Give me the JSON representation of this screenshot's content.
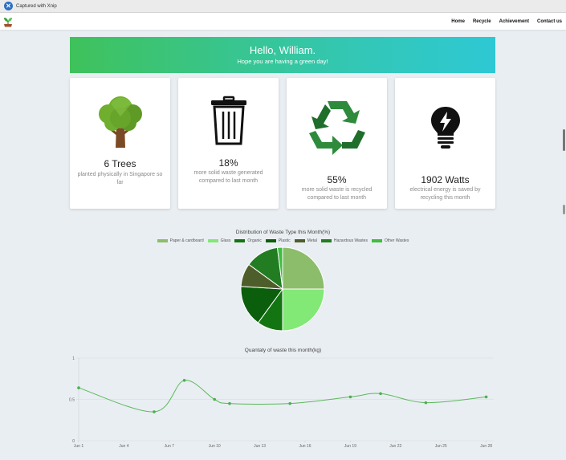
{
  "capture_bar": {
    "text": "Captured with Xnip"
  },
  "nav": {
    "links": [
      "Home",
      "Recycle",
      "Achievement",
      "Contact us"
    ]
  },
  "banner": {
    "title": "Hello, William.",
    "subtitle": "Hope you are having a green day!"
  },
  "cards": [
    {
      "icon": "tree-icon",
      "value": "6 Trees",
      "description": "planted physically in Singapore so far"
    },
    {
      "icon": "trash-bin-icon",
      "value": "18%",
      "description": "more solid waste generated compared to last month"
    },
    {
      "icon": "recycle-icon",
      "value": "55%",
      "description": "more solid waste is recycled compared to last month"
    },
    {
      "icon": "light-bulb-icon",
      "value": "1902 Watts",
      "description": "electrical energy is saved by recycling this month"
    }
  ],
  "colors": {
    "banner_start": "#3fc25b",
    "banner_end": "#2ec8d4",
    "line": "#5cb85c"
  },
  "chart_data": [
    {
      "type": "pie",
      "title": "Distribution of Waste Type this Month(%)",
      "legend_position": "top",
      "categories": [
        "Paper & cardboard",
        "Glass",
        "Organic",
        "Plastic",
        "Metal",
        "Hazardous Wastes",
        "Other Wastes"
      ],
      "values": [
        25,
        25,
        10,
        16,
        9,
        13,
        2
      ],
      "colors": [
        "#8cbd6b",
        "#82e876",
        "#137512",
        "#0b5e0b",
        "#4e5e2a",
        "#227d22",
        "#3fbd3f"
      ]
    },
    {
      "type": "line",
      "title": "Quantaty of waste this month(kg)",
      "grid": true,
      "ylim": [
        0,
        1
      ],
      "yticks": [
        0,
        0.5,
        1
      ],
      "xticks": [
        "Jun 1",
        "Jun 4",
        "Jun 7",
        "Jun 10",
        "Jun 13",
        "Jun 16",
        "Jun 19",
        "Jun 22",
        "Jun 25",
        "Jun 28"
      ],
      "x": [
        1,
        6,
        8,
        10,
        11,
        15,
        19,
        21,
        24,
        28
      ],
      "y": [
        0.64,
        0.35,
        0.73,
        0.5,
        0.45,
        0.45,
        0.53,
        0.57,
        0.46,
        0.53
      ]
    }
  ]
}
